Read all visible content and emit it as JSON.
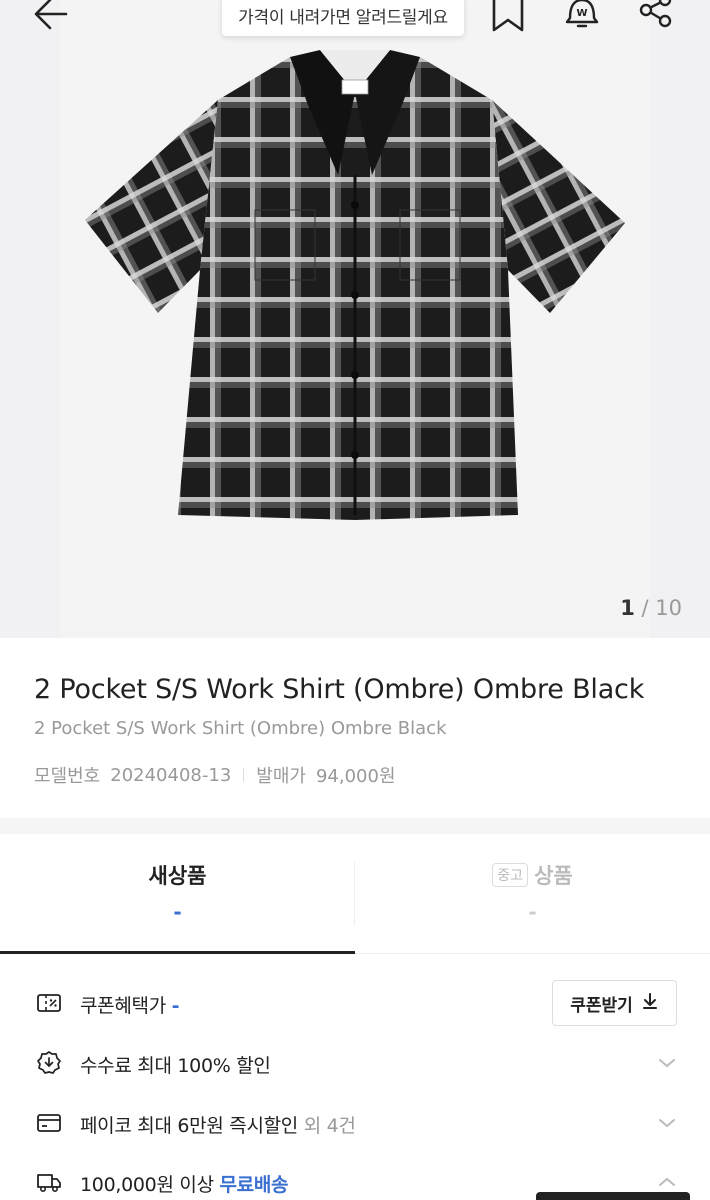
{
  "header": {
    "tooltip": "가격이 내려가면 알려드릴게요",
    "icons": [
      "back-arrow-icon",
      "bookmark-icon",
      "bell-icon",
      "share-icon"
    ]
  },
  "gallery": {
    "current": "1",
    "separator": " / ",
    "total": "10"
  },
  "product": {
    "title": "2 Pocket S/S Work Shirt (Ombre) Ombre Black",
    "subtitle": "2 Pocket S/S Work Shirt (Ombre) Ombre Black",
    "model_label": "모델번호",
    "model_value": "20240408-13",
    "release_label": "발매가",
    "release_value": "94,000원"
  },
  "tabs": {
    "new_label": "새상품",
    "new_price": "-",
    "used_badge": "중고",
    "used_label": "상품",
    "used_price": "-"
  },
  "benefits": {
    "coupon_label": "쿠폰혜택가",
    "coupon_value": "-",
    "coupon_button": "쿠폰받기",
    "fee_label": "수수료 최대 100% 할인",
    "pay_label": "페이코 최대 6만원 즉시할인",
    "pay_extra": "외 4건",
    "ship_label": "100,000원 이상",
    "ship_highlight": "무료배송"
  },
  "colors": {
    "accent": "#3a6fd1",
    "text": "#222222",
    "muted": "#999999"
  }
}
